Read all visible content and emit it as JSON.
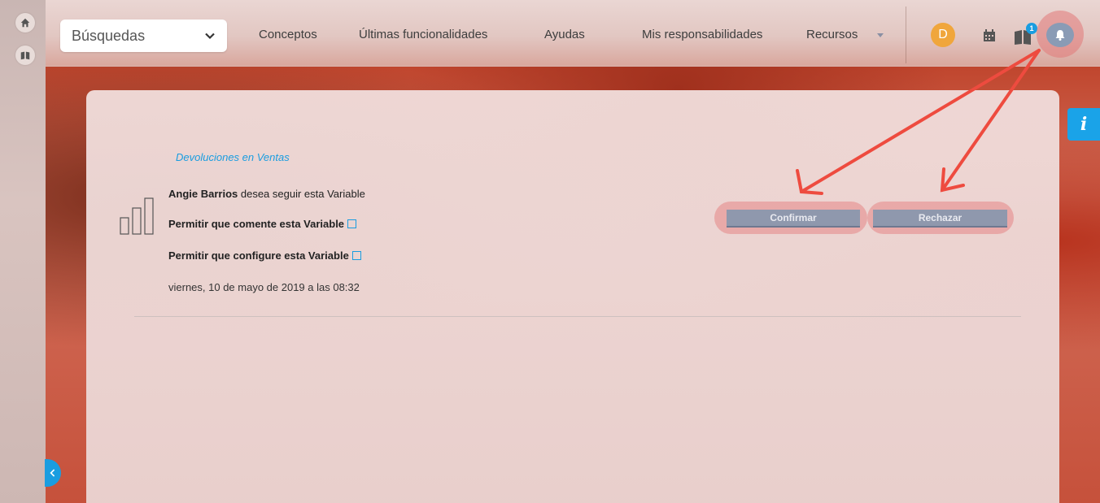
{
  "header": {
    "search_select": {
      "value": "Búsquedas",
      "icon": "chevron-down-icon"
    },
    "nav": [
      {
        "label": "Conceptos"
      },
      {
        "label": "Últimas funcionalidades"
      },
      {
        "label": "Ayudas"
      },
      {
        "label": "Mis responsabilidades"
      },
      {
        "label": "Recursos"
      }
    ],
    "avatar_initial": "D",
    "notification_count": "1"
  },
  "sidebar": {
    "items": [
      {
        "icon": "home-icon"
      },
      {
        "icon": "book-icon"
      }
    ]
  },
  "request": {
    "variable_link": "Devoluciones en Ventas",
    "user_name": "Angie Barrios",
    "message": " desea seguir esta Variable",
    "permission_comment": "Permitir que comente esta Variable",
    "permission_configure": "Permitir que configure esta Variable",
    "date": "viernes, 10 de mayo de 2019 a las 08:32"
  },
  "actions": {
    "confirm_label": "Confirmar",
    "reject_label": "Rechazar"
  },
  "info_tab_label": "i",
  "colors": {
    "accent": "#1a9de0",
    "avatar": "#f0a63c",
    "button": "#8f98ad",
    "arrow": "#ee4b3f"
  }
}
